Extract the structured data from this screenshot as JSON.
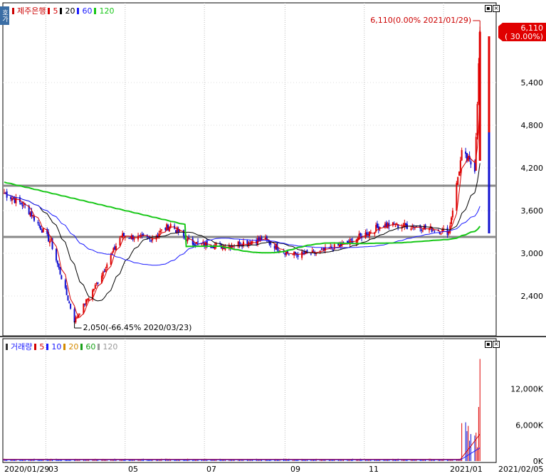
{
  "price_panel": {
    "title": "제주은행",
    "legend": [
      {
        "label": "5",
        "color": "#d40000"
      },
      {
        "label": "20",
        "color": "#000000"
      },
      {
        "label": "60",
        "color": "#1a1aff"
      },
      {
        "label": "120",
        "color": "#17c717"
      }
    ],
    "side_tab": "호가",
    "y_ticks": [
      "5,400",
      "4,800",
      "4,200",
      "3,600",
      "3,000",
      "2,400"
    ],
    "last_price_label": "6,110",
    "last_change_label": "( 30.00%)",
    "high_annotation": "6,110(0.00% 2021/01/29)",
    "low_annotation": "2,050(-66.45% 2020/03/23)"
  },
  "volume_panel": {
    "title": "거래량",
    "legend": [
      {
        "label": "5",
        "color": "#d40000"
      },
      {
        "label": "10",
        "color": "#1a1aff"
      },
      {
        "label": "20",
        "color": "#d48a00"
      },
      {
        "label": "60",
        "color": "#17a017"
      },
      {
        "label": "120",
        "color": "#999999"
      }
    ],
    "y_ticks": [
      "12,000K",
      "6,000K",
      "0K"
    ]
  },
  "x_axis": {
    "labels": [
      "2020/01/29",
      "03",
      "05",
      "07",
      "09",
      "11",
      "2021/01",
      "2021/02/05"
    ]
  },
  "colors": {
    "up": "#e00000",
    "down": "#1010d0",
    "ma5": "#d40000",
    "ma20": "#000000",
    "ma60": "#1a1aff",
    "ma120": "#17c717",
    "guide": "#888888"
  },
  "chart_data": {
    "type": "candlestick",
    "title": "제주은행",
    "x_range": [
      "2020-01-29",
      "2021-02-05"
    ],
    "y_axis_ticks": [
      2400,
      3000,
      3600,
      4200,
      4800,
      5400
    ],
    "price_range_visible": [
      2000,
      6300
    ],
    "horizontal_lines": [
      3950,
      3230
    ],
    "monthly_close_approx": [
      {
        "date": "2020-01-29",
        "price": 3850
      },
      {
        "date": "2020-02-15",
        "price": 3650
      },
      {
        "date": "2020-03-05",
        "price": 3150
      },
      {
        "date": "2020-03-23",
        "price": 2050
      },
      {
        "date": "2020-04-10",
        "price": 2600
      },
      {
        "date": "2020-04-28",
        "price": 3250
      },
      {
        "date": "2020-05-20",
        "price": 3200
      },
      {
        "date": "2020-06-05",
        "price": 3400
      },
      {
        "date": "2020-06-20",
        "price": 3150
      },
      {
        "date": "2020-07-15",
        "price": 3100
      },
      {
        "date": "2020-08-15",
        "price": 3200
      },
      {
        "date": "2020-09-05",
        "price": 2980
      },
      {
        "date": "2020-09-25",
        "price": 3000
      },
      {
        "date": "2020-10-20",
        "price": 3150
      },
      {
        "date": "2020-11-15",
        "price": 3400
      },
      {
        "date": "2020-12-10",
        "price": 3380
      },
      {
        "date": "2021-01-05",
        "price": 3300
      },
      {
        "date": "2021-01-15",
        "price": 4400
      },
      {
        "date": "2021-01-25",
        "price": 4200
      },
      {
        "date": "2021-01-29",
        "price": 6110
      },
      {
        "date": "2021-02-05",
        "price": 4700
      }
    ],
    "volume_ticks": [
      0,
      6000,
      12000
    ],
    "volume_unit": "K"
  }
}
